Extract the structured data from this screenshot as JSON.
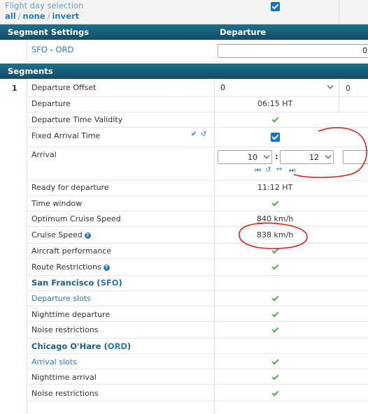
{
  "flight_day_selection": {
    "title": "Flight day selection",
    "link_all": "all",
    "link_none": "none",
    "link_invert": "invert",
    "sep": "/"
  },
  "segment_settings": {
    "header_left": "Segment Settings",
    "header_right": "Departure",
    "route_from": "SFO",
    "route_dash": " - ",
    "route_to": "ORD",
    "departure_input_value": "0"
  },
  "segments": {
    "header": "Segments",
    "index": "1",
    "rows": {
      "departure_offset": {
        "label": "Departure Offset",
        "select_value": "0",
        "second_value": "0"
      },
      "departure": {
        "label": "Departure",
        "value": "06:15 HT"
      },
      "departure_time_validity": {
        "label": "Departure Time Validity"
      },
      "fixed_arrival_time": {
        "label": "Fixed Arrival Time"
      },
      "arrival": {
        "label": "Arrival",
        "hour": "10",
        "colon": ":",
        "minute": "12"
      },
      "ready_for_departure": {
        "label": "Ready for departure",
        "value": "11:12 HT"
      },
      "time_window": {
        "label": "Time window"
      },
      "optimum_cruise_speed": {
        "label": "Optimum Cruise Speed",
        "value": "840 km/h"
      },
      "cruise_speed": {
        "label": "Cruise Speed",
        "value": "838 km/h"
      },
      "aircraft_performance": {
        "label": "Aircraft performance"
      },
      "route_restrictions": {
        "label": "Route Restrictions"
      }
    },
    "sfo": {
      "name": "San Francisco",
      "code": "SFO",
      "rows": [
        "Departure slots",
        "Nighttime departure",
        "Noise restrictions"
      ]
    },
    "ord": {
      "name": "Chicago O'Hare",
      "code": "ORD",
      "rows": [
        "Arrival slots",
        "Nighttime arrival",
        "Noise restrictions"
      ]
    }
  },
  "colors": {
    "header_bg": "#1e6f8c",
    "link": "#2b7bb9",
    "check": "#4caf50",
    "annotation": "#e0201b"
  }
}
